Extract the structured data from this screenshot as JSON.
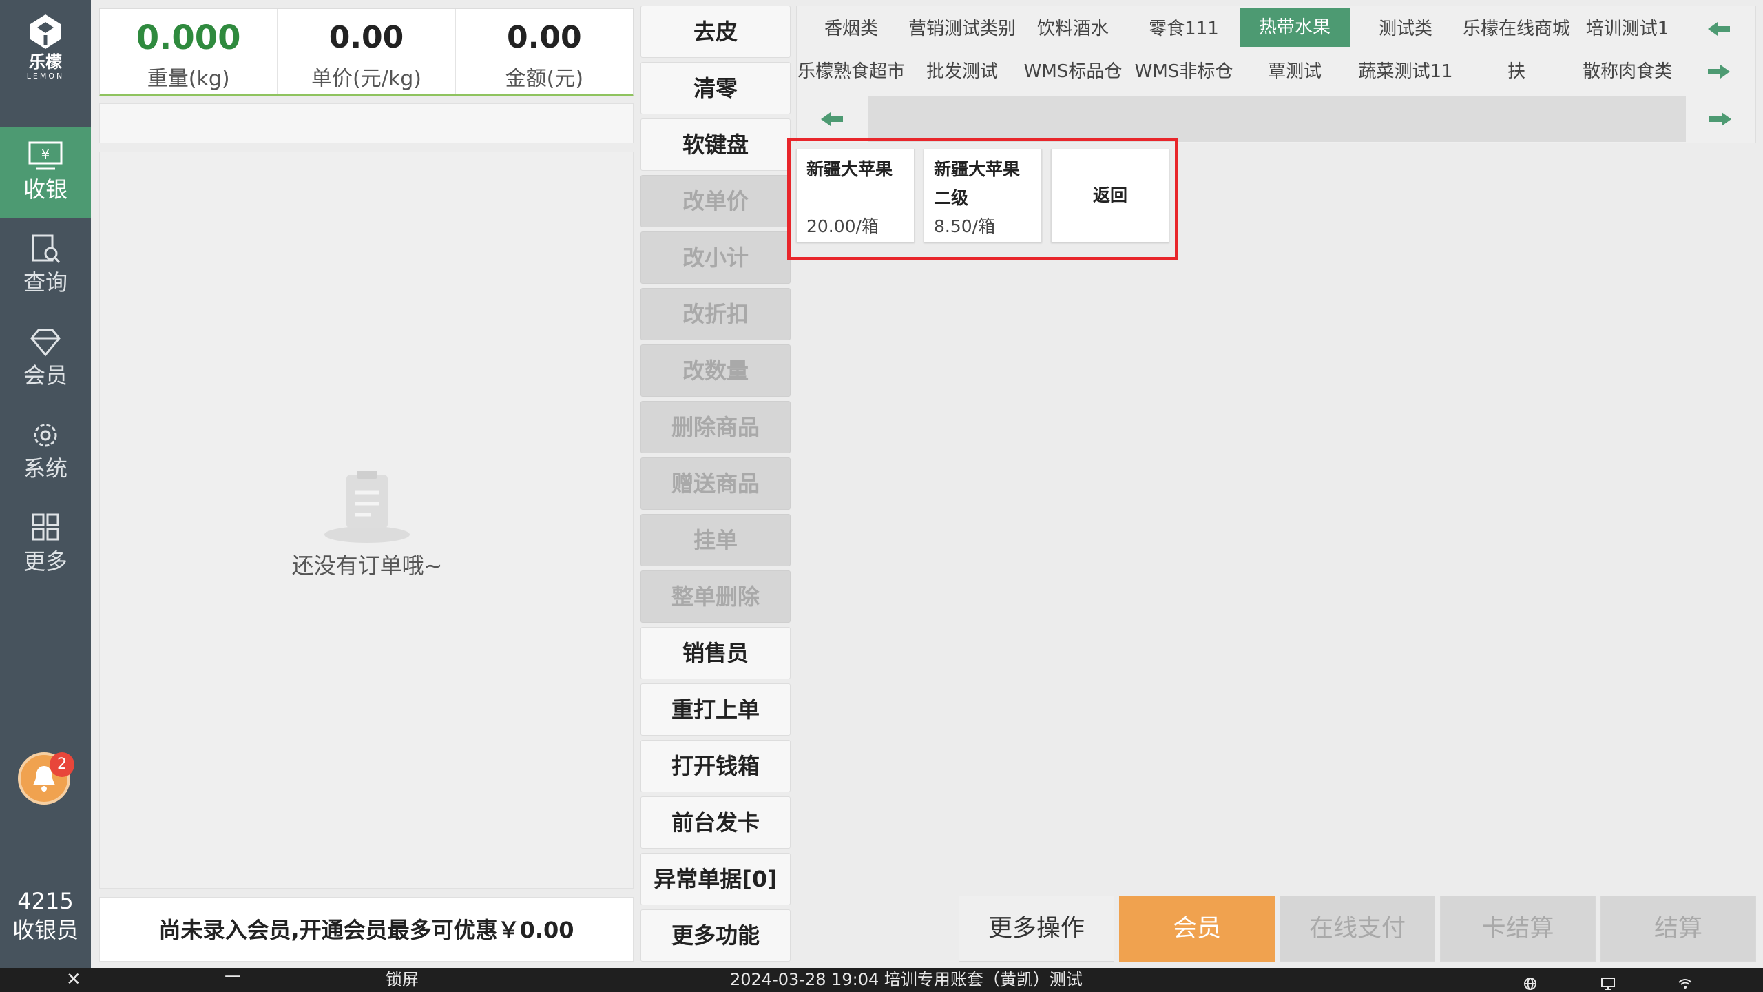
{
  "sidebar": {
    "logo": {
      "cn": "乐檬",
      "en": "LEMON"
    },
    "items": [
      {
        "label": "收银",
        "icon": "cash-register-icon"
      },
      {
        "label": "查询",
        "icon": "search-doc-icon"
      },
      {
        "label": "会员",
        "icon": "diamond-icon"
      },
      {
        "label": "系统",
        "icon": "gear-icon"
      },
      {
        "label": "更多",
        "icon": "grid-icon"
      }
    ],
    "notification_count": "2",
    "user_id": "4215",
    "user_role": "收银员"
  },
  "scale": {
    "weight": {
      "value": "0.000",
      "label": "重量(kg)"
    },
    "unit_price": {
      "value": "0.00",
      "label": "单价(元/kg)"
    },
    "amount": {
      "value": "0.00",
      "label": "金额(元)"
    }
  },
  "barcode_input": {
    "value": ""
  },
  "order": {
    "empty_text": "还没有订单哦~"
  },
  "member_notice": "尚未录入会员,开通会员最多可优惠￥0.00",
  "functions": [
    {
      "label": "去皮",
      "enabled": true
    },
    {
      "label": "清零",
      "enabled": true
    },
    {
      "label": "软键盘",
      "enabled": true
    },
    {
      "label": "改单价",
      "enabled": false
    },
    {
      "label": "改小计",
      "enabled": false
    },
    {
      "label": "改折扣",
      "enabled": false
    },
    {
      "label": "改数量",
      "enabled": false
    },
    {
      "label": "删除商品",
      "enabled": false
    },
    {
      "label": "赠送商品",
      "enabled": false
    },
    {
      "label": "挂单",
      "enabled": false
    },
    {
      "label": "整单删除",
      "enabled": false
    },
    {
      "label": "销售员",
      "enabled": true
    },
    {
      "label": "重打上单",
      "enabled": true
    },
    {
      "label": "打开钱箱",
      "enabled": true
    },
    {
      "label": "前台发卡",
      "enabled": true
    },
    {
      "label": "异常单据[0]",
      "enabled": true
    },
    {
      "label": "更多功能",
      "enabled": true
    }
  ],
  "categories": {
    "row1": [
      "香烟类",
      "营销测试类别",
      "饮料酒水",
      "零食111",
      "热带水果",
      "测试类",
      "乐檬在线商城",
      "培训测试1"
    ],
    "row2": [
      "乐檬熟食超市",
      "批发测试",
      "WMS标品仓",
      "WMS非标仓",
      "覃测试",
      "蔬菜测试11",
      "扶",
      "散称肉食类"
    ],
    "active": "热带水果"
  },
  "products": [
    {
      "name": "新疆大苹果",
      "price": "20.00/箱"
    },
    {
      "name": "新疆大苹果二级",
      "price": "8.50/箱"
    }
  ],
  "back_label": "返回",
  "actions": {
    "more": "更多操作",
    "member": "会员",
    "online_pay": "在线支付",
    "card_pay": "卡结算",
    "checkout": "结算"
  },
  "statusbar": {
    "lock": "锁屏",
    "info": "2024-03-28 19:04 培训专用账套（黄凯）测试"
  },
  "colors": {
    "sidebar": "#47535d",
    "accent_green": "#4d9a72",
    "member_orange": "#f0a24f",
    "highlight_red": "#e8262b"
  }
}
